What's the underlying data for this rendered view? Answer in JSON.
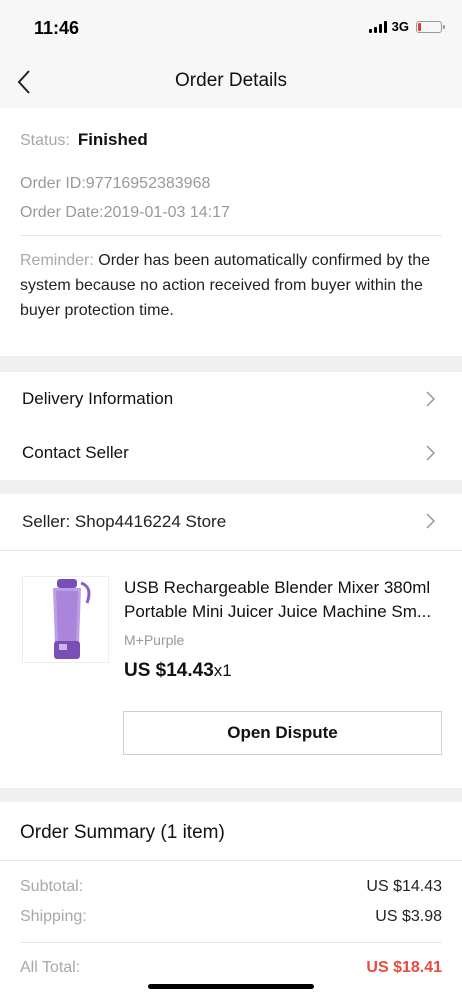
{
  "status_bar": {
    "time": "11:46",
    "network": "3G"
  },
  "nav": {
    "title": "Order Details"
  },
  "order": {
    "status_label": "Status:",
    "status_value": "Finished",
    "order_id": "Order ID:97716952383968",
    "order_date": "Order Date:2019-01-03 14:17",
    "reminder_label": "Reminder:",
    "reminder_text": " Order has been automatically confirmed by the system because no action received from buyer within the buyer protection time."
  },
  "links": {
    "delivery": "Delivery Information",
    "contact": "Contact Seller"
  },
  "product": {
    "seller": "Seller: Shop4416224 Store",
    "title": "USB Rechargeable Blender Mixer 380ml Portable Mini Juicer Juice Machine Sm...",
    "variant": "M+Purple",
    "price": "US $14.43",
    "quantity": "x1",
    "dispute_label": "Open Dispute"
  },
  "summary": {
    "title": "Order Summary (1 item)",
    "subtotal_label": "Subtotal:",
    "subtotal_value": "US $14.43",
    "shipping_label": "Shipping:",
    "shipping_value": "US $3.98",
    "total_label": "All Total:",
    "total_value": "US $18.41"
  },
  "colors": {
    "accent_total": "#e84a3e",
    "product_purple": "#8a5ec4"
  },
  "icons": [
    "back-arrow-icon",
    "chevron-right-icon",
    "signal-icon",
    "battery-icon"
  ]
}
